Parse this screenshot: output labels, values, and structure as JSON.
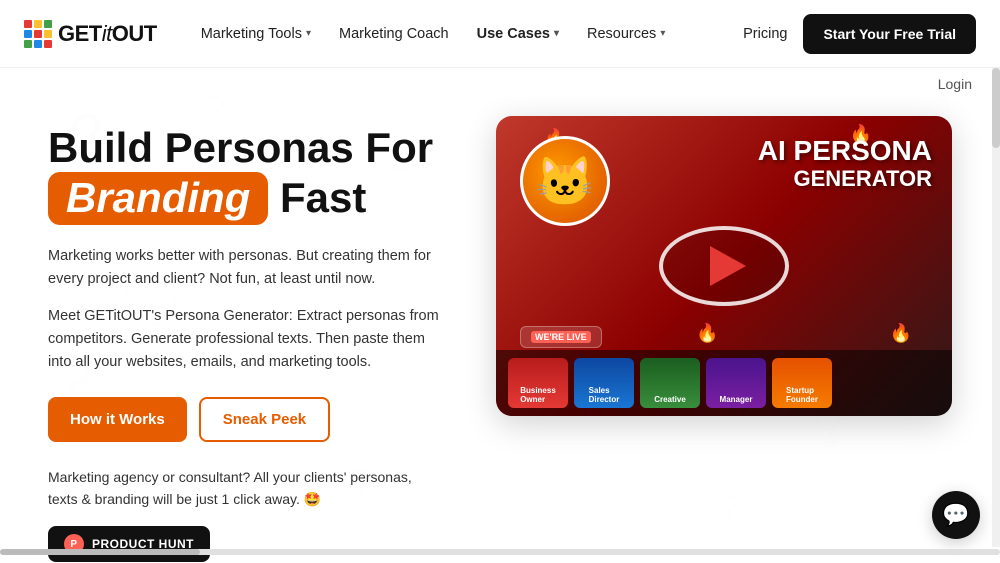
{
  "logo": {
    "text_get": "GET",
    "text_it": "it",
    "text_out": "OUT"
  },
  "nav": {
    "marketing_tools": "Marketing Tools",
    "marketing_coach": "Marketing Coach",
    "use_cases": "Use Cases",
    "resources": "Resources",
    "pricing": "Pricing",
    "trial_button": "Start Your Free Trial",
    "login": "Login"
  },
  "hero": {
    "title_prefix": "Build Personas For",
    "title_highlight": "Branding",
    "title_suffix": "Fast",
    "desc1": "Marketing works better with personas. But creating them for every project and client? Not fun, at least until now.",
    "desc2": "Meet GETitOUT's Persona Generator: Extract personas from competitors. Generate professional texts. Then paste them into all your websites, emails, and marketing tools.",
    "btn_how": "How it Works",
    "btn_sneak": "Sneak Peek",
    "bottom_text": "Marketing agency or consultant? All your clients' personas, texts & branding will be just 1 click away. 🤩",
    "ph_badge": "PRODUCT HUNT",
    "video_title_line1": "AI PERSONA",
    "video_title_line2": "GENERATOR",
    "ph_live": "WE'RE LIVE",
    "card_labels": [
      "Business Owner",
      "Sales Director",
      "Creative",
      "Manager",
      "Startup Founder"
    ]
  },
  "colors": {
    "accent": "#e65c00",
    "dark": "#111111",
    "white": "#ffffff"
  }
}
